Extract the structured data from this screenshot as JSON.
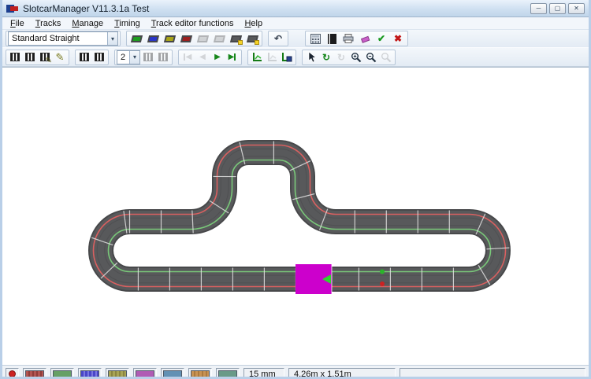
{
  "window": {
    "title": "SlotcarManager V11.3.1a Test",
    "controls": {
      "minimize": "─",
      "maximize": "▢",
      "close": "✕"
    }
  },
  "menu": {
    "items": [
      "File",
      "Tracks",
      "Manage",
      "Timing",
      "Track editor functions",
      "Help"
    ]
  },
  "toolbar_top": {
    "piece_selector": {
      "value": "Standard Straight",
      "arrow": "▾"
    },
    "piece_colors": [
      "#1f9d1f",
      "#2a35c8",
      "#a8a418",
      "#9c2020",
      "#9a9a9a",
      "#9a9a9a",
      "#58595b",
      "#58595b"
    ],
    "undo_glyph": "↶",
    "confirm_glyph": "✔",
    "cancel_glyph": "✖"
  },
  "toolbar_edit": {
    "lane_selector": {
      "value": "2",
      "arrow": "▾"
    },
    "nav": {
      "first": "◀",
      "prev": "◀",
      "next": "▶",
      "last": "▶"
    },
    "rotate_glyph": "↻",
    "pencil_glyph": "✎"
  },
  "statusbar": {
    "record_color": "#cc2222",
    "swatches": [
      {
        "name": "swatch-red",
        "color": "#b25551",
        "stripe": "#8f3c39"
      },
      {
        "name": "swatch-green",
        "color": "#66a066",
        "stripe": "#66a066"
      },
      {
        "name": "swatch-blue",
        "color": "#4946c8",
        "stripe": "#7a78e0"
      },
      {
        "name": "swatch-olive",
        "color": "#a8a455",
        "stripe": "#8a8440"
      },
      {
        "name": "swatch-purple",
        "color": "#b05cb4",
        "stripe": "#b05cb4"
      },
      {
        "name": "swatch-steel",
        "color": "#6291b4",
        "stripe": "#6291b4"
      },
      {
        "name": "swatch-tan",
        "color": "#c89354",
        "stripe": "#ab7a3e"
      },
      {
        "name": "swatch-teal",
        "color": "#699a88",
        "stripe": "#699a88"
      }
    ],
    "grid_size": "15 mm",
    "track_dimensions": "4.26m x 1.51m"
  },
  "canvas": {
    "background": "#ffffff",
    "track": {
      "road_color": "#58595b",
      "edge_color": "#47484a",
      "slot_color": "#4d4e50",
      "outer_lane_color": "#d96060",
      "inner_lane_color": "#79c879",
      "joint_color": "#e2e2e2",
      "road_width": 29,
      "joint_spacing": 40
    },
    "selected_piece": {
      "fill": "#cc00cc",
      "arrow": "#2fd42f"
    },
    "markers": {
      "start_color": "#2ab52a",
      "finish_color": "#cc2222"
    }
  }
}
